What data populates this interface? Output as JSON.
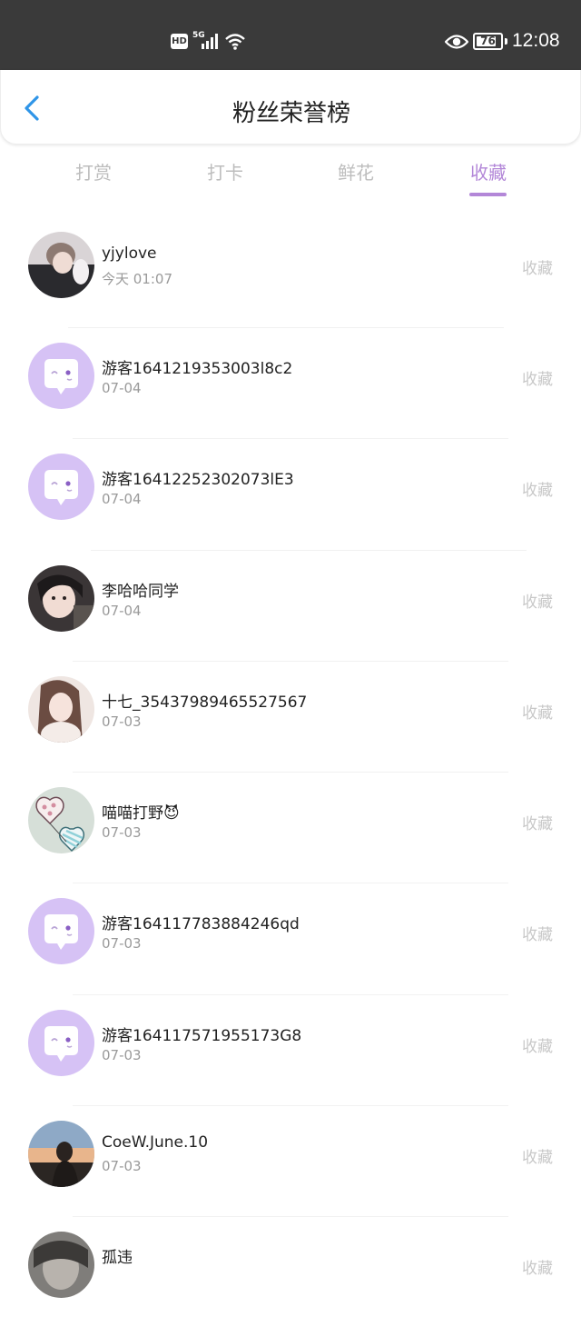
{
  "status_bar": {
    "hd": "HD",
    "network": "5G",
    "battery": "76",
    "time": "12:08"
  },
  "header": {
    "title": "粉丝荣誉榜"
  },
  "tabs": [
    {
      "label": "打赏",
      "active": false
    },
    {
      "label": "打卡",
      "active": false
    },
    {
      "label": "鲜花",
      "active": false
    },
    {
      "label": "收藏",
      "active": true
    }
  ],
  "colors": {
    "accent": "#b387d8",
    "placeholder_avatar": "#d6c2f5"
  },
  "fans": [
    {
      "name": "yjylove",
      "date": "今天 01:07",
      "action": "收藏",
      "avatar": "photo-avatar"
    },
    {
      "name": "游客1641219353003l8c2",
      "date": "07-04",
      "action": "收藏",
      "avatar": "chat-bubble-icon"
    },
    {
      "name": "游客16412252302073lE3",
      "date": "07-04",
      "action": "收藏",
      "avatar": "chat-bubble-icon"
    },
    {
      "name": "李哈哈同学",
      "date": "07-04",
      "action": "收藏",
      "avatar": "photo-avatar"
    },
    {
      "name": "十七_35437989465527567",
      "date": "07-03",
      "action": "收藏",
      "avatar": "photo-avatar"
    },
    {
      "name": "喵喵打野😈",
      "date": "07-03",
      "action": "收藏",
      "avatar": "balloon-avatar"
    },
    {
      "name": "游客164117783884246qd",
      "date": "07-03",
      "action": "收藏",
      "avatar": "chat-bubble-icon"
    },
    {
      "name": "游客164117571955173G8",
      "date": "07-03",
      "action": "收藏",
      "avatar": "chat-bubble-icon"
    },
    {
      "name": "CoeW.June.10",
      "date": "07-03",
      "action": "收藏",
      "avatar": "photo-avatar"
    },
    {
      "name": "孤违",
      "date": "",
      "action": "收藏",
      "avatar": "photo-avatar"
    }
  ]
}
